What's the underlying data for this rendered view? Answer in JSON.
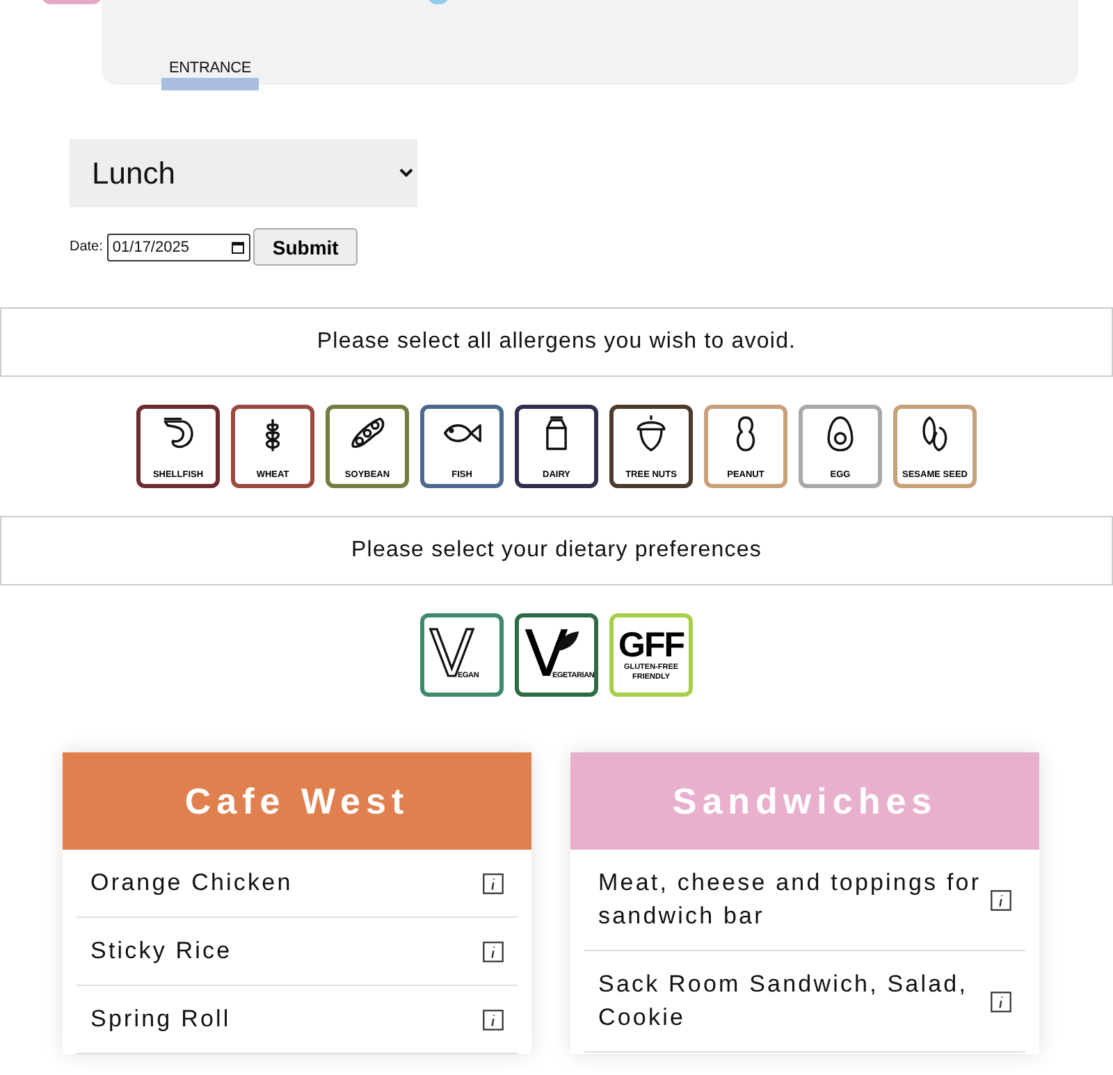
{
  "map": {
    "entrance_label": "ENTRANCE"
  },
  "meal_select": {
    "value": "Lunch"
  },
  "date": {
    "label": "Date:",
    "value": "01/17/2025"
  },
  "submit_label": "Submit",
  "allergen_prompt": "Please select all allergens you wish to avoid.",
  "allergens": [
    {
      "kind": "shellfish",
      "label": "SHELLFISH",
      "color": "#6e2b30"
    },
    {
      "kind": "wheat",
      "label": "WHEAT",
      "color": "#9c4a3e"
    },
    {
      "kind": "soybean",
      "label": "SOYBEAN",
      "color": "#6f7d3e"
    },
    {
      "kind": "fish",
      "label": "FISH",
      "color": "#4b6a8e"
    },
    {
      "kind": "dairy",
      "label": "DAIRY",
      "color": "#2f2f4d"
    },
    {
      "kind": "treenuts",
      "label": "TREE NUTS",
      "color": "#4a3b2b"
    },
    {
      "kind": "peanut",
      "label": "PEANUT",
      "color": "#c8a07a"
    },
    {
      "kind": "egg",
      "label": "EGG",
      "color": "#a9a9a9"
    },
    {
      "kind": "sesame",
      "label": "SESAME SEED",
      "color": "#c8a07a"
    }
  ],
  "diet_prompt": "Please select your dietary preferences",
  "diets": [
    {
      "kind": "vegan",
      "mark": "V",
      "label": "EGAN",
      "color": "#3e8a6a"
    },
    {
      "kind": "vegetarian",
      "mark": "V",
      "label": "EGETARIAN",
      "color": "#2f6a45"
    },
    {
      "kind": "gff",
      "mark": "GFF",
      "label": "GLUTEN-FREE FRIENDLY",
      "color": "#a6d04a"
    }
  ],
  "stations": [
    {
      "name": "Cafe West",
      "color": "#e0804f",
      "items": [
        "Orange Chicken",
        "Sticky Rice",
        "Spring Roll"
      ]
    },
    {
      "name": "Sandwiches",
      "color": "#e8b0cd",
      "items": [
        "Meat, cheese and toppings for sandwich bar",
        "Sack Room Sandwich, Salad, Cookie"
      ]
    }
  ]
}
